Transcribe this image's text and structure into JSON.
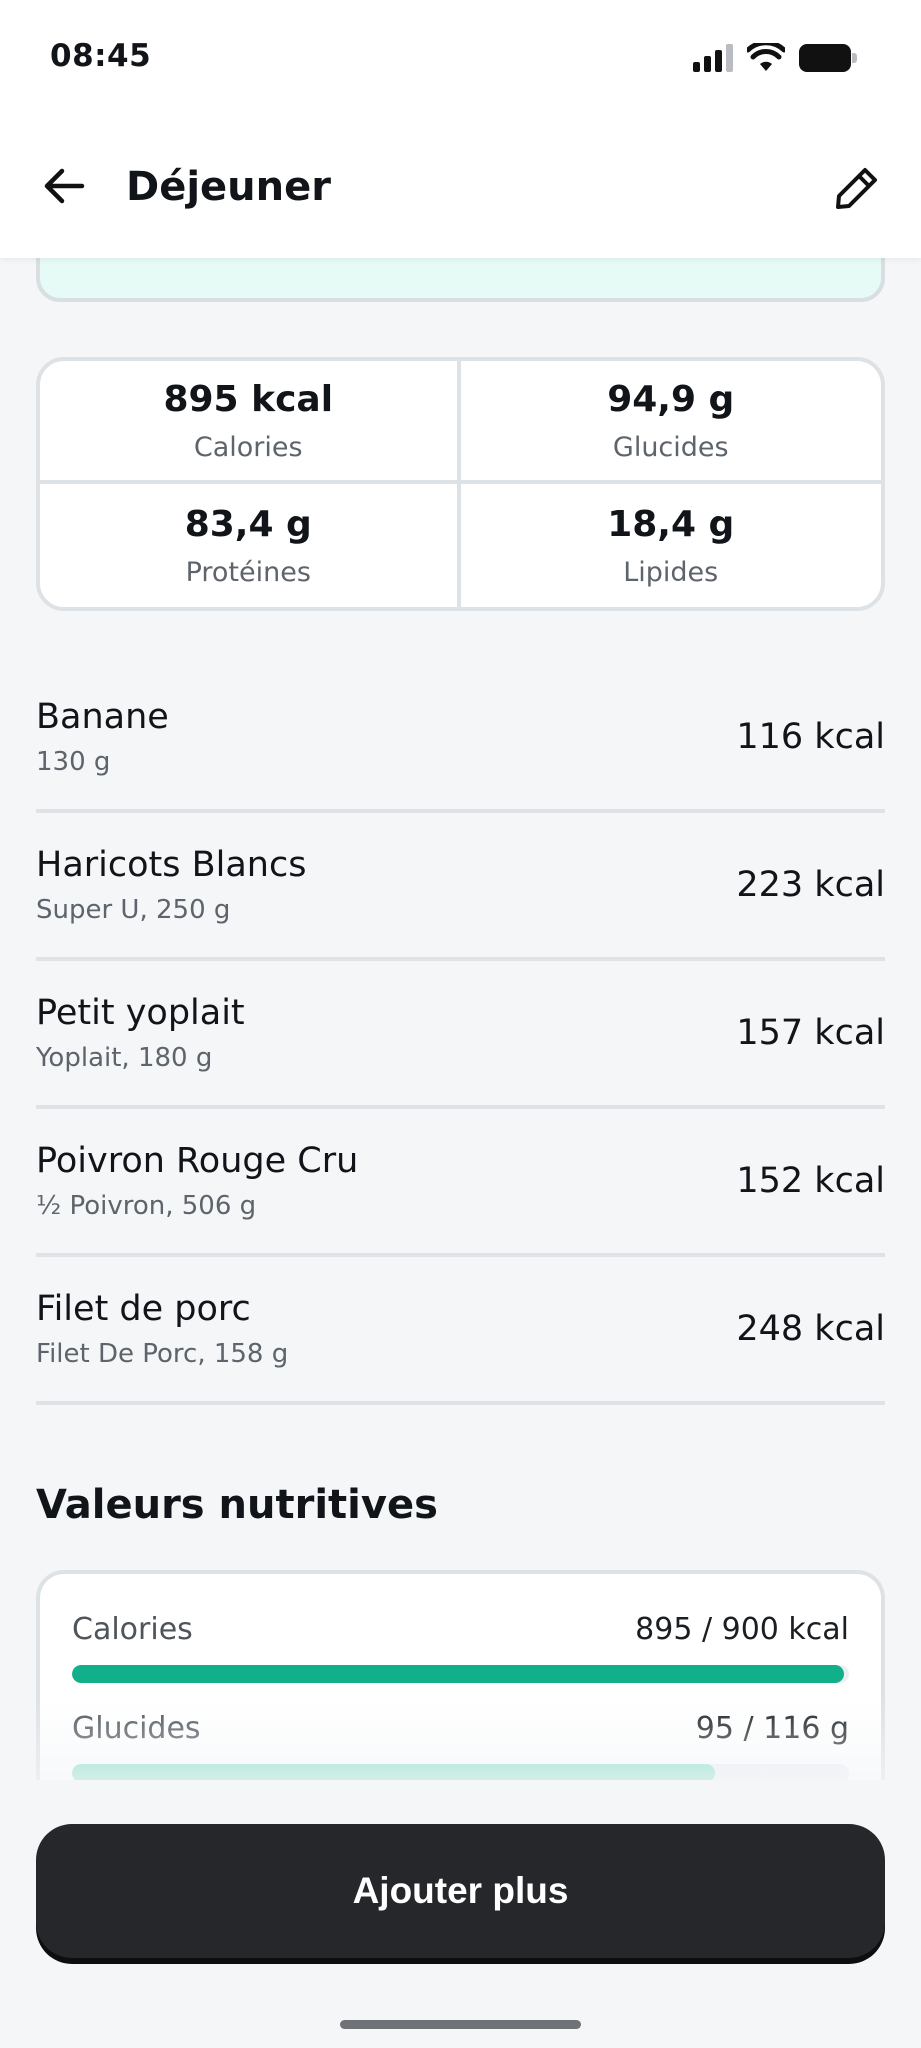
{
  "status_bar": {
    "time": "08:45"
  },
  "header": {
    "title": "Déjeuner"
  },
  "macros": [
    {
      "value": "895 kcal",
      "label": "Calories"
    },
    {
      "value": "94,9 g",
      "label": "Glucides"
    },
    {
      "value": "83,4 g",
      "label": "Protéines"
    },
    {
      "value": "18,4 g",
      "label": "Lipides"
    }
  ],
  "foods": [
    {
      "name": "Banane",
      "detail": "130 g",
      "kcal": "116 kcal"
    },
    {
      "name": "Haricots Blancs",
      "detail": "Super U, 250 g",
      "kcal": "223 kcal"
    },
    {
      "name": "Petit yoplait",
      "detail": "Yoplait, 180 g",
      "kcal": "157 kcal"
    },
    {
      "name": "Poivron Rouge Cru",
      "detail": "½ Poivron, 506 g",
      "kcal": "152 kcal"
    },
    {
      "name": "Filet de porc",
      "detail": "Filet De Porc, 158 g",
      "kcal": "248 kcal"
    }
  ],
  "nutrition": {
    "title": "Valeurs nutritives",
    "rows": [
      {
        "label": "Calories",
        "value": "895 / 900 kcal",
        "progress": 0.994,
        "color": "#12b08a"
      },
      {
        "label": "Glucides",
        "value": "95 / 116 g",
        "progress": 0.828,
        "color": "#7fdcc4"
      }
    ]
  },
  "actions": {
    "add_more": "Ajouter plus"
  },
  "icons": {
    "back": "arrow-left-icon",
    "edit": "pencil-icon"
  }
}
